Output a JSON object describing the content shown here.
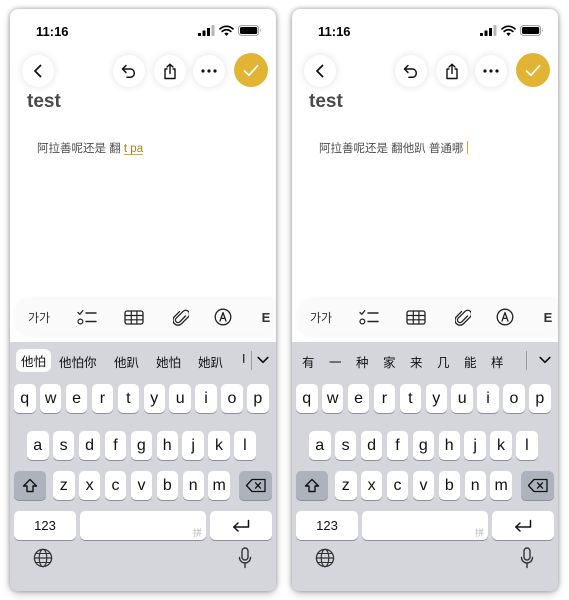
{
  "screens": [
    {
      "status": {
        "time": "11:16"
      },
      "note": {
        "title": "test",
        "body_plain": "阿拉善呢还是 翻",
        "body_marked": "t pa",
        "show_caret": false
      },
      "format_bar": {
        "text_style_label": "가가"
      },
      "candidates": {
        "items": [
          "他怕",
          "他怕你",
          "他趴",
          "她怕",
          "她趴",
          "I"
        ],
        "selected_index": 0
      },
      "keyboard": {
        "row1": [
          "q",
          "w",
          "e",
          "r",
          "t",
          "y",
          "u",
          "i",
          "o",
          "p"
        ],
        "row2": [
          "a",
          "s",
          "d",
          "f",
          "g",
          "h",
          "j",
          "k",
          "l"
        ],
        "row3": [
          "z",
          "x",
          "c",
          "v",
          "b",
          "n",
          "m"
        ],
        "numbers_label": "123",
        "space_watermark": "拼"
      }
    },
    {
      "status": {
        "time": "11:16"
      },
      "note": {
        "title": "test",
        "body_plain": "阿拉善呢还是 翻他趴 普通哪",
        "body_marked": "",
        "show_caret": true
      },
      "format_bar": {
        "text_style_label": "가가"
      },
      "candidates": {
        "items": [
          "有",
          "一",
          "种",
          "家",
          "来",
          "几",
          "能",
          "样"
        ],
        "selected_index": -1
      },
      "keyboard": {
        "row1": [
          "q",
          "w",
          "e",
          "r",
          "t",
          "y",
          "u",
          "i",
          "o",
          "p"
        ],
        "row2": [
          "a",
          "s",
          "d",
          "f",
          "g",
          "h",
          "j",
          "k",
          "l"
        ],
        "row3": [
          "z",
          "x",
          "c",
          "v",
          "b",
          "n",
          "m"
        ],
        "numbers_label": "123",
        "space_watermark": "拼"
      }
    }
  ],
  "colors": {
    "accent": "#e2b434",
    "keyboard_bg": "#d4d6dc",
    "key_bg": "#ffffff",
    "key_dark": "#aeb2bc"
  }
}
